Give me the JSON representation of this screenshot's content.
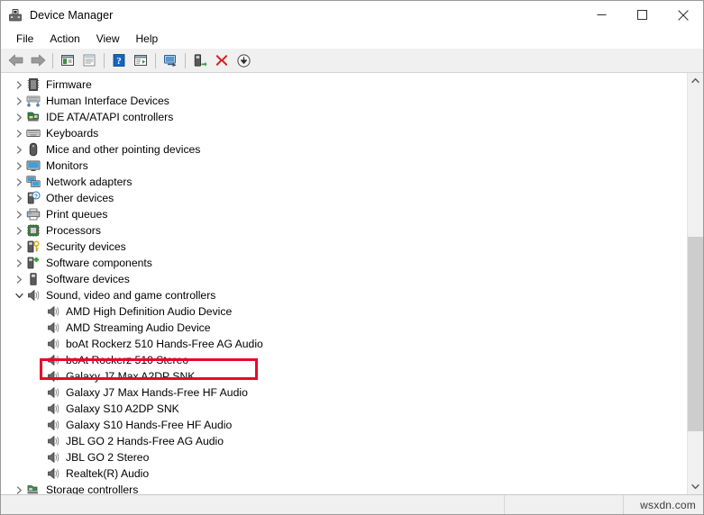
{
  "window": {
    "title": "Device Manager",
    "icon": "device-manager-icon",
    "controls": {
      "minimize": "minimize-icon",
      "maximize": "maximize-icon",
      "close": "close-icon"
    }
  },
  "menubar": {
    "items": [
      {
        "label": "File"
      },
      {
        "label": "Action"
      },
      {
        "label": "View"
      },
      {
        "label": "Help"
      }
    ]
  },
  "toolbar": {
    "buttons": [
      {
        "name": "back-arrow-icon",
        "tooltip": "Back"
      },
      {
        "name": "forward-arrow-icon",
        "tooltip": "Forward"
      },
      {
        "name": "separator-1"
      },
      {
        "name": "show-hide-console-tree-icon",
        "tooltip": "Show/Hide Console Tree"
      },
      {
        "name": "properties-icon",
        "tooltip": "Properties"
      },
      {
        "name": "separator-2"
      },
      {
        "name": "help-icon",
        "tooltip": "Help"
      },
      {
        "name": "show-hide-action-pane-icon",
        "tooltip": "Show/Hide Action Pane"
      },
      {
        "name": "separator-3"
      },
      {
        "name": "scan-for-hardware-changes-icon",
        "tooltip": "Scan for hardware changes"
      },
      {
        "name": "separator-4"
      },
      {
        "name": "update-driver-icon",
        "tooltip": "Update driver"
      },
      {
        "name": "uninstall-device-icon",
        "tooltip": "Uninstall device"
      },
      {
        "name": "disable-device-icon",
        "tooltip": "Disable device"
      }
    ]
  },
  "tree": {
    "nodes": [
      {
        "label": "Firmware",
        "icon": "firmware-icon",
        "level": 0,
        "expanded": false,
        "chevron": "chevron-right"
      },
      {
        "label": "Human Interface Devices",
        "icon": "hid-icon",
        "level": 0,
        "expanded": false,
        "chevron": "chevron-right"
      },
      {
        "label": "IDE ATA/ATAPI controllers",
        "icon": "ide-controller-icon",
        "level": 0,
        "expanded": false,
        "chevron": "chevron-right"
      },
      {
        "label": "Keyboards",
        "icon": "keyboard-icon",
        "level": 0,
        "expanded": false,
        "chevron": "chevron-right"
      },
      {
        "label": "Mice and other pointing devices",
        "icon": "mouse-icon",
        "level": 0,
        "expanded": false,
        "chevron": "chevron-right"
      },
      {
        "label": "Monitors",
        "icon": "monitor-icon",
        "level": 0,
        "expanded": false,
        "chevron": "chevron-right"
      },
      {
        "label": "Network adapters",
        "icon": "network-adapter-icon",
        "level": 0,
        "expanded": false,
        "chevron": "chevron-right"
      },
      {
        "label": "Other devices",
        "icon": "other-devices-icon",
        "level": 0,
        "expanded": false,
        "chevron": "chevron-right"
      },
      {
        "label": "Print queues",
        "icon": "printer-icon",
        "level": 0,
        "expanded": false,
        "chevron": "chevron-right"
      },
      {
        "label": "Processors",
        "icon": "processor-icon",
        "level": 0,
        "expanded": false,
        "chevron": "chevron-right"
      },
      {
        "label": "Security devices",
        "icon": "security-device-icon",
        "level": 0,
        "expanded": false,
        "chevron": "chevron-right"
      },
      {
        "label": "Software components",
        "icon": "software-component-icon",
        "level": 0,
        "expanded": false,
        "chevron": "chevron-right"
      },
      {
        "label": "Software devices",
        "icon": "software-device-icon",
        "level": 0,
        "expanded": false,
        "chevron": "chevron-right"
      },
      {
        "label": "Sound, video and game controllers",
        "icon": "sound-controller-icon",
        "level": 0,
        "expanded": true,
        "chevron": "chevron-down",
        "highlighted": true
      },
      {
        "label": "AMD High Definition Audio Device",
        "icon": "speaker-icon",
        "level": 1,
        "expanded": null,
        "chevron": "none"
      },
      {
        "label": "AMD Streaming Audio Device",
        "icon": "speaker-icon",
        "level": 1,
        "expanded": null,
        "chevron": "none"
      },
      {
        "label": "boAt Rockerz 510 Hands-Free AG Audio",
        "icon": "speaker-icon",
        "level": 1,
        "expanded": null,
        "chevron": "none"
      },
      {
        "label": "boAt Rockerz 510 Stereo",
        "icon": "speaker-icon",
        "level": 1,
        "expanded": null,
        "chevron": "none"
      },
      {
        "label": "Galaxy J7 Max A2DP SNK",
        "icon": "speaker-icon",
        "level": 1,
        "expanded": null,
        "chevron": "none"
      },
      {
        "label": "Galaxy J7 Max Hands-Free HF Audio",
        "icon": "speaker-icon",
        "level": 1,
        "expanded": null,
        "chevron": "none"
      },
      {
        "label": "Galaxy S10 A2DP SNK",
        "icon": "speaker-icon",
        "level": 1,
        "expanded": null,
        "chevron": "none"
      },
      {
        "label": "Galaxy S10 Hands-Free HF Audio",
        "icon": "speaker-icon",
        "level": 1,
        "expanded": null,
        "chevron": "none"
      },
      {
        "label": "JBL GO 2 Hands-Free AG Audio",
        "icon": "speaker-icon",
        "level": 1,
        "expanded": null,
        "chevron": "none"
      },
      {
        "label": "JBL GO 2 Stereo",
        "icon": "speaker-icon",
        "level": 1,
        "expanded": null,
        "chevron": "none"
      },
      {
        "label": "Realtek(R) Audio",
        "icon": "speaker-icon",
        "level": 1,
        "expanded": null,
        "chevron": "none"
      },
      {
        "label": "Storage controllers",
        "icon": "storage-controller-icon",
        "level": 0,
        "expanded": false,
        "chevron": "chevron-right"
      }
    ]
  },
  "highlight": {
    "color": "#e8092a",
    "target_label": "Sound, video and game controllers"
  },
  "scrollbar": {
    "up_arrow": "scroll-up-icon",
    "down_arrow": "scroll-down-icon",
    "thumb": "scroll-thumb"
  },
  "statusbar": {
    "pane1": "",
    "pane2": "",
    "watermark": "wsxdn.com"
  }
}
